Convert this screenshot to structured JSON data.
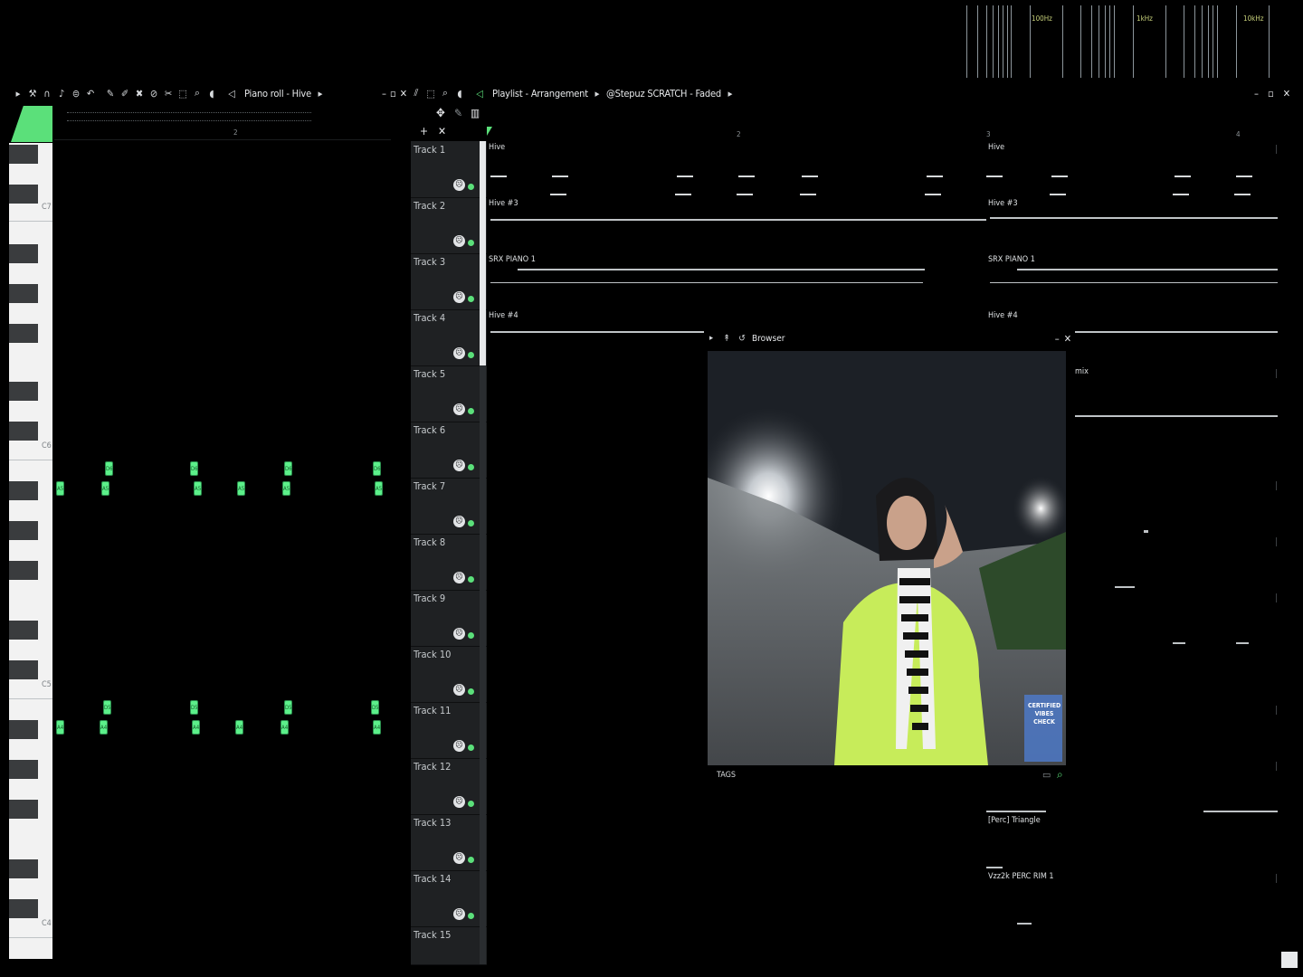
{
  "spectrum": {
    "labels": [
      "100Hz",
      "1kHz",
      "10kHz"
    ]
  },
  "piano_roll": {
    "icons": [
      "arrow-icon",
      "wrench-icon",
      "magnet-icon",
      "note-icon",
      "stamp-icon",
      "undo-icon",
      "pencil-icon",
      "brush-icon",
      "delete-icon",
      "mute-icon",
      "slice-icon",
      "select-icon",
      "zoom-icon",
      "playback-icon",
      "speaker-icon"
    ],
    "title": "Piano roll - Hive",
    "ruler": [
      "2"
    ],
    "key_labels": [
      "C7",
      "C6",
      "C5",
      "C4"
    ],
    "note_text_high_upper": "D6",
    "note_text_high_lower": "A5",
    "note_text_low_upper": "D5",
    "note_text_low_lower": "A4"
  },
  "playlist": {
    "title": "Playlist - Arrangement",
    "pattern": "@Stepuz SCRATCH - Faded",
    "ruler": [
      "2",
      "3",
      "4"
    ],
    "tracks": [
      "Track 1",
      "Track 2",
      "Track 3",
      "Track 4",
      "Track 5",
      "Track 6",
      "Track 7",
      "Track 8",
      "Track 9",
      "Track 10",
      "Track 11",
      "Track 12",
      "Track 13",
      "Track 14",
      "Track 15"
    ],
    "clips": {
      "hive": "Hive",
      "hive3": "Hive #3",
      "srx": "SRX PIANO 1",
      "hive4": "Hive #4",
      "mix": "mix",
      "triangle": "[Perc] Triangle",
      "rim": "Vzz2k PERC RIM 1"
    }
  },
  "browser": {
    "title": "Browser",
    "tags_label": "TAGS",
    "watermark": "CERTIFIED VIBES CHECK"
  },
  "colors": {
    "accent_green": "#5be07a",
    "note_green": "#5cf08a",
    "panel_dark": "#1f2123"
  }
}
